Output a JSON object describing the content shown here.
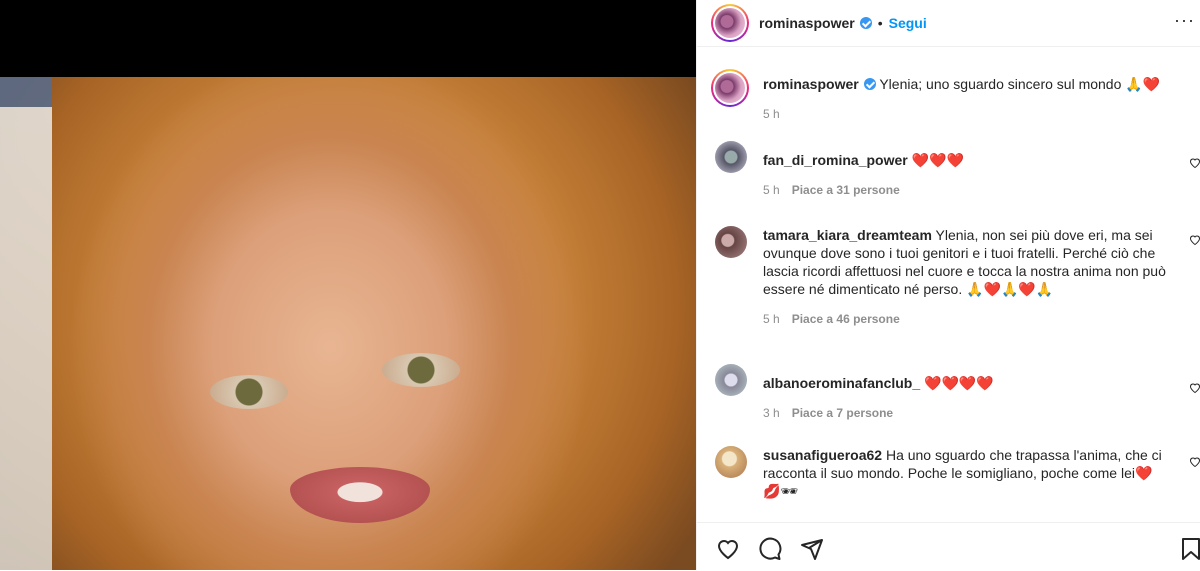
{
  "post": {
    "username": "rominaspower",
    "follow_label": "Segui",
    "separator": "•",
    "more_label": "···",
    "caption_text": "Ylenia; uno sguardo sincero sul mondo 🙏❤️",
    "caption_time": "5 h"
  },
  "comments": [
    {
      "username": "fan_di_romina_power",
      "text": "❤️❤️❤️",
      "time": "5 h",
      "likes": "Piace a 31 persone"
    },
    {
      "username": "tamara_kiara_dreamteam",
      "text": "Ylenia, non sei più dove eri, ma sei ovunque dove sono i tuoi genitori e i tuoi fratelli. Perché ciò che lascia ricordi affettuosi nel cuore e tocca la nostra anima non può essere né dimenticato né perso. 🙏❤️🙏❤️🙏",
      "time": "5 h",
      "likes": "Piace a 46 persone"
    },
    {
      "username": "albanoerominafanclub_",
      "text": "❤️❤️❤️❤️",
      "time": "3 h",
      "likes": "Piace a 7 persone"
    },
    {
      "username": "susanafigueroa62",
      "text": "Ha uno sguardo che trapassa l'anima, che ci racconta il suo mondo. Poche le somigliano, poche come lei❤️ 💋🕶",
      "time": "",
      "likes": ""
    }
  ],
  "icons": [
    "heart-icon",
    "comment-icon",
    "share-icon",
    "bookmark-icon",
    "verified-icon"
  ],
  "colors": {
    "accent": "#0095f6",
    "verified": "#3897f0",
    "muted": "#8e8e8e"
  }
}
